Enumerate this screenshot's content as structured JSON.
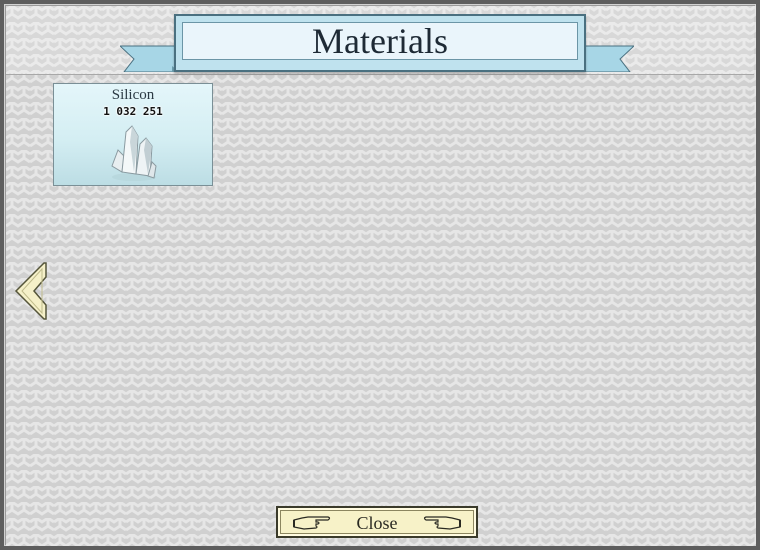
{
  "dialog": {
    "title": "Materials"
  },
  "materials": [
    {
      "name": "Silicon",
      "count": "1 032 251",
      "icon": "crystal-icon"
    }
  ],
  "navigation": {
    "prev_icon": "left-arrow-icon"
  },
  "footer": {
    "close_label": "Close",
    "left_icon": "pointing-hand-right-icon",
    "right_icon": "pointing-hand-left-icon"
  },
  "colors": {
    "background": "#d2d2d2",
    "banner": "#bfe2ee",
    "card": "#d4eef3",
    "close_button": "#f7f2c8",
    "arrow": "#f5f0c8"
  }
}
